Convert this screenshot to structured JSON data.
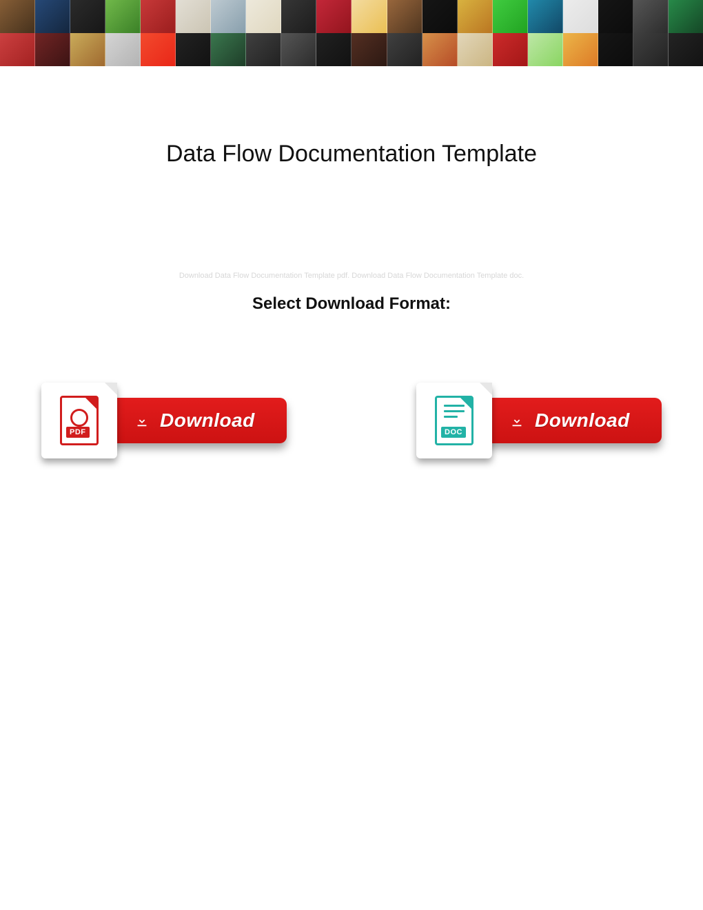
{
  "title": "Data Flow Documentation Template",
  "subtitle": "Select Download Format:",
  "watermark": "Download Data Flow Documentation Template pdf. Download Data Flow Documentation Template doc.",
  "downloads": {
    "pdf": {
      "icon_label": "PDF",
      "button_label": "Download"
    },
    "doc": {
      "icon_label": "DOC",
      "button_label": "Download"
    }
  },
  "colors": {
    "pdf": "#d11d1d",
    "doc": "#22b2a6",
    "button_bg": "#e21c1c"
  }
}
